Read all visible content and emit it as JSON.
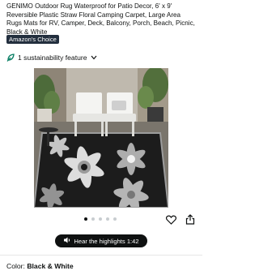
{
  "product": {
    "title": "GENIMO Outdoor Rug Waterproof for Patio Decor, 6' x 9' Reversible Plastic Straw Floral Camping Carpet, Large Area Rugs Mats for RV, Camper, Deck, Balcony, Porch, Beach, Picnic, Black & White",
    "badge": {
      "prefix": "Amazon's",
      "suffix": "Choice",
      "color": "#232f3e"
    },
    "sustainability": {
      "label": "1 sustainability feature",
      "icon": "leaf-icon",
      "accent": "#067d62"
    }
  },
  "gallery": {
    "image_alt": "Black and white floral outdoor rug on patio with white chairs and plants",
    "dots_count": 5,
    "active_dot": 1
  },
  "actions": {
    "favorite_icon": "heart-icon",
    "share_icon": "share-icon"
  },
  "audio": {
    "label": "Hear the highlights 1:42",
    "icon": "audio-wave-icon"
  },
  "variation": {
    "label": "Color:",
    "value": "Black & White"
  }
}
